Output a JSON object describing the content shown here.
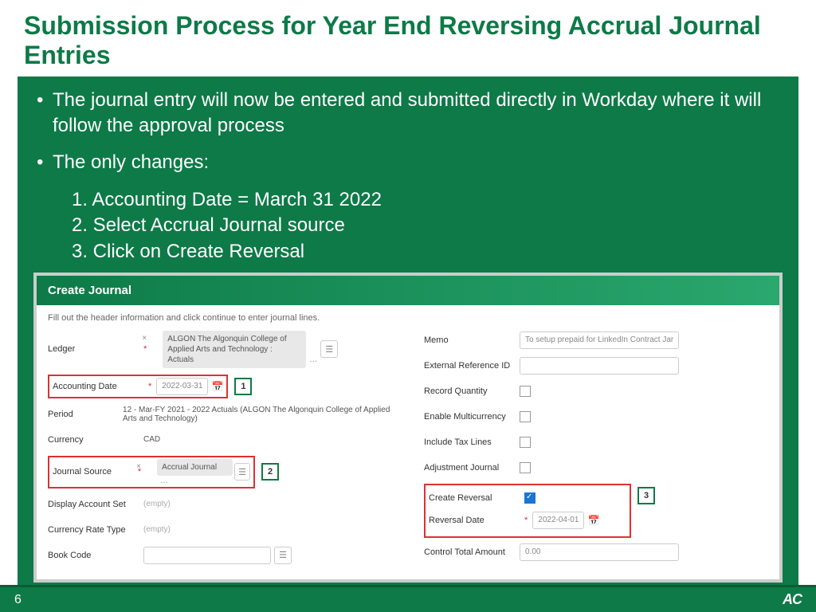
{
  "title": "Submission Process for Year End Reversing Accrual Journal Entries",
  "bullets": {
    "b1": "The journal entry will now be entered and submitted directly in Workday where it will follow the approval process",
    "b2": "The only changes:",
    "s1": "1. Accounting Date = March 31 2022",
    "s2": "2. Select Accrual Journal source",
    "s3": "3. Click on Create Reversal"
  },
  "app": {
    "header": "Create Journal",
    "instr": "Fill out the header information and click continue to enter journal lines.",
    "left": {
      "ledger_lbl": "Ledger",
      "ledger_val": "ALGON The Algonquin College of Applied Arts and Technology : Actuals",
      "acct_date_lbl": "Accounting Date",
      "acct_date_val": "2022-03-31",
      "callout1": "1",
      "period_lbl": "Period",
      "period_val": "12 - Mar-FY 2021 - 2022 Actuals (ALGON The Algonquin College of Applied Arts and Technology)",
      "currency_lbl": "Currency",
      "currency_val": "CAD",
      "jsource_lbl": "Journal Source",
      "jsource_val": "Accrual Journal",
      "callout2": "2",
      "dispacct_lbl": "Display Account Set",
      "dispacct_val": "(empty)",
      "currate_lbl": "Currency Rate Type",
      "currate_val": "(empty)",
      "bookcode_lbl": "Book Code"
    },
    "right": {
      "memo_lbl": "Memo",
      "memo_val": "To setup prepaid for LinkedIn Contract Jar",
      "extref_lbl": "External Reference ID",
      "recqty_lbl": "Record Quantity",
      "multi_lbl": "Enable Multicurrency",
      "tax_lbl": "Include Tax Lines",
      "adj_lbl": "Adjustment Journal",
      "crev_lbl": "Create Reversal",
      "revdate_lbl": "Reversal Date",
      "revdate_val": "2022-04-01",
      "callout3": "3",
      "ctrltot_lbl": "Control Total Amount",
      "ctrltot_val": "0.00"
    }
  },
  "footer": {
    "page": "6",
    "logo": "AC"
  }
}
